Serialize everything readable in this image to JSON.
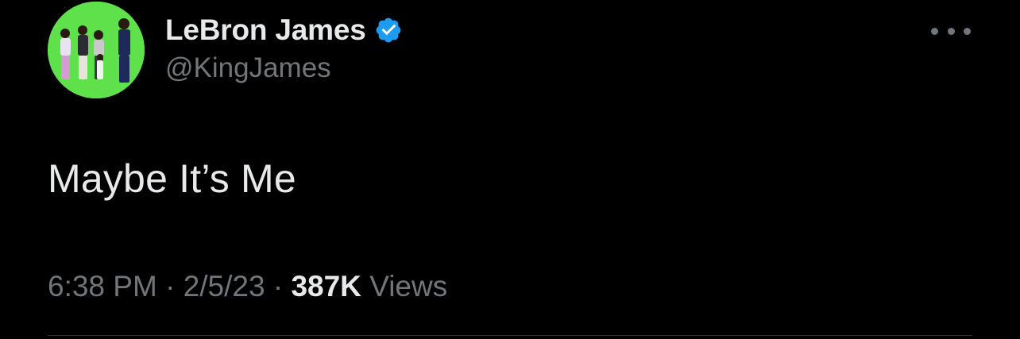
{
  "author": {
    "display_name": "LeBron James",
    "handle": "@KingJames",
    "verified": true,
    "avatar_bg": "#5ee14a"
  },
  "tweet": {
    "text": "Maybe It’s Me",
    "time": "6:38 PM",
    "separator": "·",
    "date": "2/5/23",
    "views_count": "387K",
    "views_label": "Views"
  },
  "icons": {
    "more": "more-horizontal-icon",
    "verified": "verified-badge-icon"
  },
  "colors": {
    "background": "#000000",
    "primary_text": "#e7e9ea",
    "secondary_text": "#71767b",
    "verified_blue": "#1d9bf0"
  }
}
